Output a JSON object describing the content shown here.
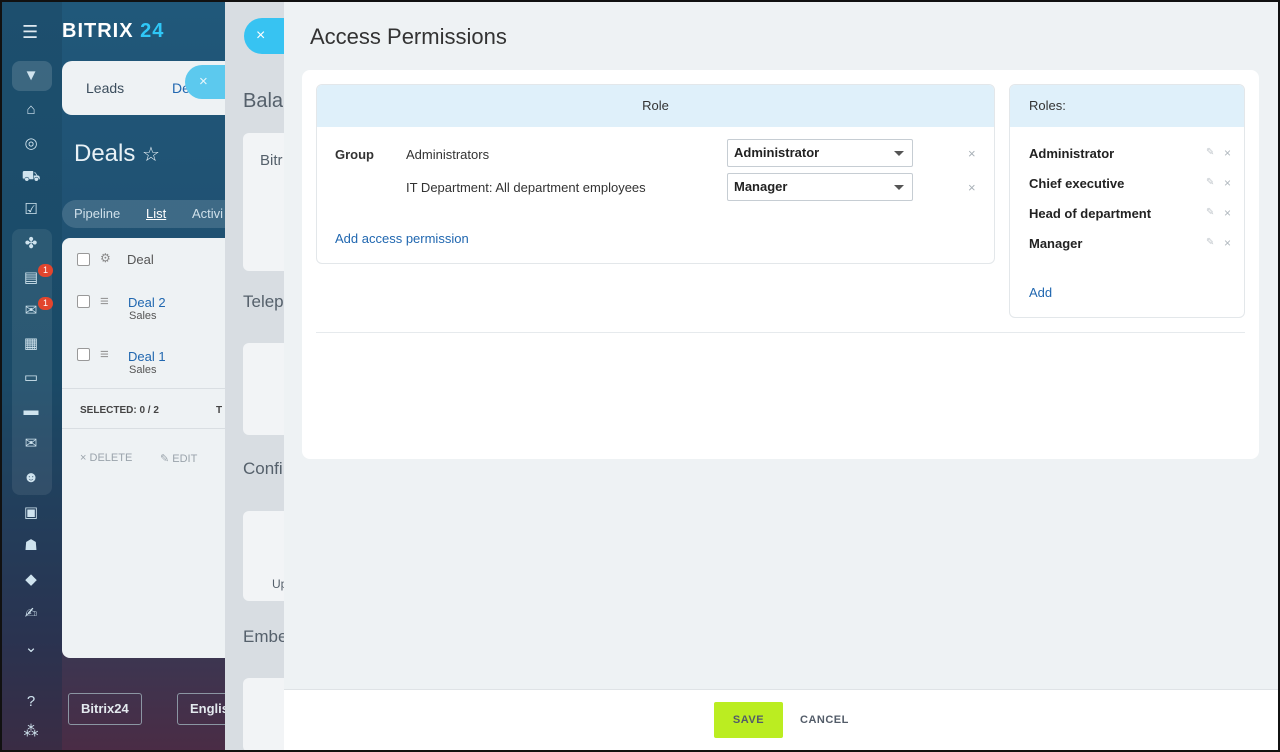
{
  "app": {
    "logo_text": "BITRIX",
    "logo_num": "24"
  },
  "sidebar": {
    "counters": [
      "1",
      "1"
    ]
  },
  "background_page": {
    "tabs": [
      "Leads",
      "De"
    ],
    "title": "Deals",
    "subtabs": [
      "Pipeline",
      "List",
      "Activi"
    ],
    "list_header": "Deal",
    "rows": [
      {
        "name": "Deal 2",
        "stage": "Sales"
      },
      {
        "name": "Deal 1",
        "stage": "Sales"
      }
    ],
    "selected": "SELECTED: 0 / 2",
    "selected_extra": "T",
    "actions": [
      "DELETE",
      "EDIT"
    ],
    "bottom_buttons": [
      "Bitrix24",
      "Englis"
    ]
  },
  "mid_slider": {
    "texts": [
      "Bala",
      "Bitr",
      "Telep",
      "Confi",
      "Up",
      "Embe"
    ]
  },
  "panel": {
    "title": "Access Permissions",
    "role_table": {
      "header": "Role",
      "group_label": "Group",
      "rows": [
        {
          "name": "Administrators",
          "role": "Administrator"
        },
        {
          "name": "IT Department: All department employees",
          "role": "Manager"
        }
      ],
      "add_link": "Add access permission",
      "remove_glyph": "×"
    },
    "roles_box": {
      "header": "Roles:",
      "items": [
        "Administrator",
        "Chief executive",
        "Head of department",
        "Manager"
      ],
      "add_link": "Add"
    },
    "footer": {
      "save_label": "SAVE",
      "cancel_label": "CANCEL"
    }
  },
  "icons": {
    "close": "×",
    "edit": "✎",
    "star": "☆",
    "gear": "⚙",
    "drag": "≡"
  },
  "colors": {
    "accent_blue": "#2fc7f7",
    "link_blue": "#2067b0",
    "save_green": "#bbed21",
    "header_blue": "#dff0fa"
  }
}
